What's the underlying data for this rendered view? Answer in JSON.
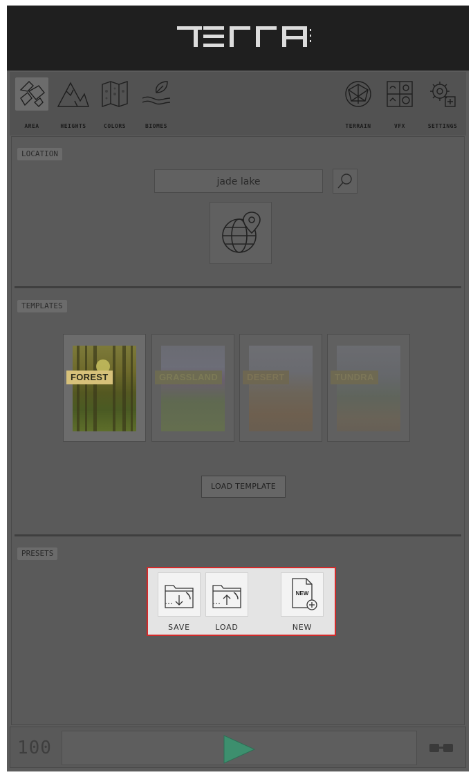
{
  "header": {
    "logo_text": "TERRA"
  },
  "toolbar": {
    "left_items": [
      {
        "label": "AREA",
        "icon": "area-icon",
        "active": true
      },
      {
        "label": "HEIGHTS",
        "icon": "mountains-icon",
        "active": false
      },
      {
        "label": "COLORS",
        "icon": "map-icon",
        "active": false
      },
      {
        "label": "BIOMES",
        "icon": "leaf-hand-icon",
        "active": false
      }
    ],
    "right_items": [
      {
        "label": "TERRAIN",
        "icon": "terrain-sphere-icon"
      },
      {
        "label": "VFX",
        "icon": "vfx-icon"
      },
      {
        "label": "SETTINGS",
        "icon": "gear-icon"
      }
    ]
  },
  "location": {
    "section_label": "LOCATION",
    "search_value": "jade lake"
  },
  "templates": {
    "section_label": "TEMPLATES",
    "items": [
      {
        "label": "FOREST",
        "highlighted": true
      },
      {
        "label": "GRASSLAND",
        "highlighted": false
      },
      {
        "label": "DESERT",
        "highlighted": false
      },
      {
        "label": "TUNDRA",
        "highlighted": false
      }
    ],
    "load_button": "LOAD TEMPLATE"
  },
  "presets": {
    "section_label": "PRESETS",
    "save_label": "SAVE",
    "load_label": "LOAD",
    "new_label": "NEW",
    "new_badge": "NEW"
  },
  "bottom": {
    "counter": "100"
  },
  "colors": {
    "accent_red": "#d22a2a",
    "play_green": "#3d8f6e",
    "template_label_bg": "#d7c17a"
  }
}
